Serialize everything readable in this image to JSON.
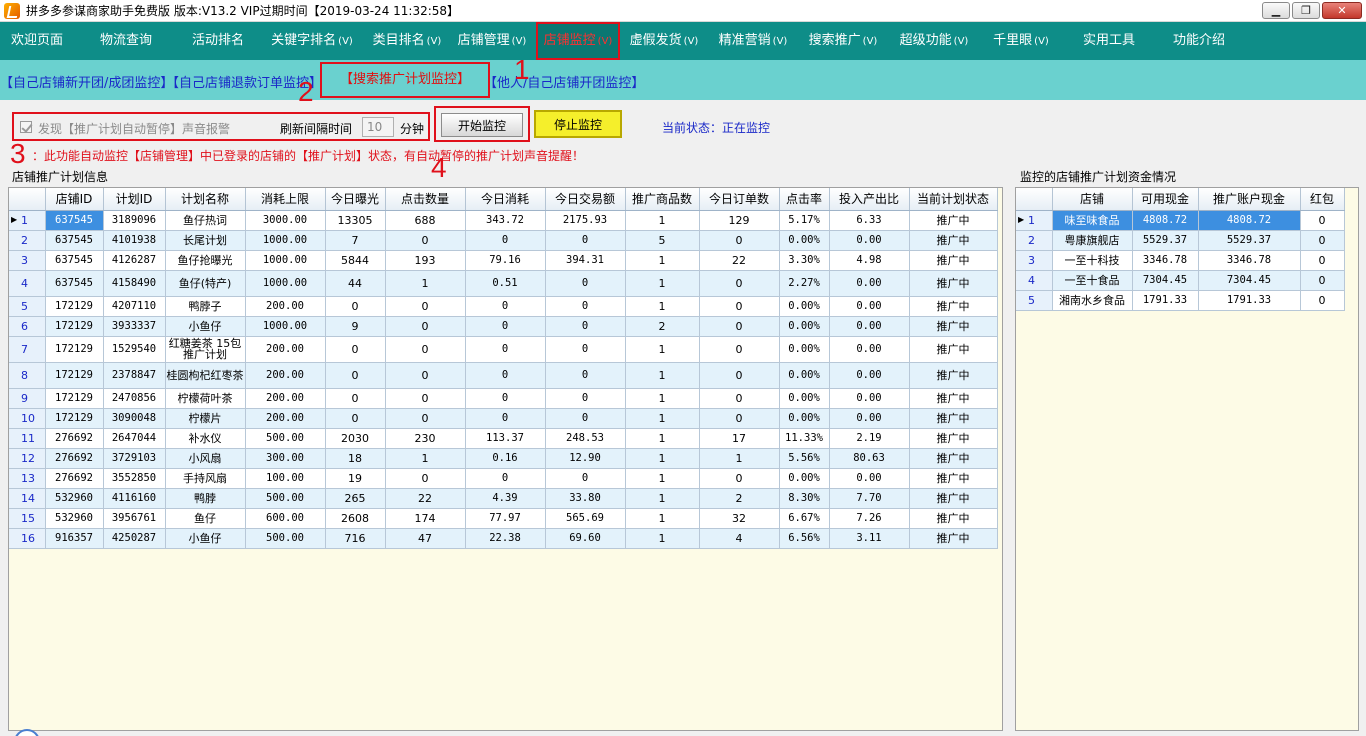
{
  "window": {
    "title": "拼多多参谋商家助手免费版 版本:V13.2 VIP过期时间【2019-03-24 11:32:58】"
  },
  "menu": [
    {
      "label": "欢迎页面",
      "sub": ""
    },
    {
      "label": "物流查询",
      "sub": ""
    },
    {
      "label": "活动排名",
      "sub": ""
    },
    {
      "label": "关键字排名",
      "sub": "(V)"
    },
    {
      "label": "类目排名",
      "sub": "(V)"
    },
    {
      "label": "店铺管理",
      "sub": "(V)"
    },
    {
      "label": "店铺监控",
      "sub": "(V)"
    },
    {
      "label": "虚假发货",
      "sub": "(V)"
    },
    {
      "label": "精准营销",
      "sub": "(V)"
    },
    {
      "label": "搜索推广",
      "sub": "(V)"
    },
    {
      "label": "超级功能",
      "sub": "(V)"
    },
    {
      "label": "千里眼",
      "sub": "(V)"
    },
    {
      "label": "实用工具",
      "sub": ""
    },
    {
      "label": "功能介绍",
      "sub": ""
    }
  ],
  "subtabs": [
    "【自己店铺新开团/成团监控】",
    "【自己店铺退款订单监控】",
    "【搜索推广计划监控】",
    "【他人/自己店铺开团监控】"
  ],
  "callouts": [
    "1",
    "2",
    "3",
    "4"
  ],
  "controls": {
    "sound_alert_label": "发现【推广计划自动暂停】声音报警",
    "interval_label": "刷新间隔时间",
    "interval_value": "10",
    "interval_unit": "分钟",
    "start_label": "开始监控",
    "stop_label": "停止监控",
    "status_label": "当前状态：正在监控"
  },
  "notice": "：此功能自动监控【店铺管理】中已登录的店铺的【推广计划】状态，有自动暂停的推广计划声音提醒！",
  "plans_panel": {
    "title": "店铺推广计划信息",
    "columns": [
      "店铺ID",
      "计划ID",
      "计划名称",
      "消耗上限",
      "今日曝光",
      "点击数量",
      "今日消耗",
      "今日交易额",
      "推广商品数",
      "今日订单数",
      "点击率",
      "投入产出比",
      "当前计划状态"
    ],
    "rows": [
      [
        "637545",
        "3189096",
        "鱼仔热词",
        "3000.00",
        "13305",
        "688",
        "343.72",
        "2175.93",
        "1",
        "129",
        "5.17%",
        "6.33",
        "推广中"
      ],
      [
        "637545",
        "4101938",
        "长尾计划",
        "1000.00",
        "7",
        "0",
        "0",
        "0",
        "5",
        "0",
        "0.00%",
        "0.00",
        "推广中"
      ],
      [
        "637545",
        "4126287",
        "鱼仔抢曝光",
        "1000.00",
        "5844",
        "193",
        "79.16",
        "394.31",
        "1",
        "22",
        "3.30%",
        "4.98",
        "推广中"
      ],
      [
        "637545",
        "4158490",
        "鱼仔(特产)",
        "1000.00",
        "44",
        "1",
        "0.51",
        "0",
        "1",
        "0",
        "2.27%",
        "0.00",
        "推广中"
      ],
      [
        "172129",
        "4207110",
        "鸭脖子",
        "200.00",
        "0",
        "0",
        "0",
        "0",
        "1",
        "0",
        "0.00%",
        "0.00",
        "推广中"
      ],
      [
        "172129",
        "3933337",
        "小鱼仔",
        "1000.00",
        "9",
        "0",
        "0",
        "0",
        "2",
        "0",
        "0.00%",
        "0.00",
        "推广中"
      ],
      [
        "172129",
        "1529540",
        "红糖姜茶 15包推广计划",
        "200.00",
        "0",
        "0",
        "0",
        "0",
        "1",
        "0",
        "0.00%",
        "0.00",
        "推广中"
      ],
      [
        "172129",
        "2378847",
        "桂圆枸杞红枣茶",
        "200.00",
        "0",
        "0",
        "0",
        "0",
        "1",
        "0",
        "0.00%",
        "0.00",
        "推广中"
      ],
      [
        "172129",
        "2470856",
        "柠檬荷叶茶",
        "200.00",
        "0",
        "0",
        "0",
        "0",
        "1",
        "0",
        "0.00%",
        "0.00",
        "推广中"
      ],
      [
        "172129",
        "3090048",
        "柠檬片",
        "200.00",
        "0",
        "0",
        "0",
        "0",
        "1",
        "0",
        "0.00%",
        "0.00",
        "推广中"
      ],
      [
        "276692",
        "2647044",
        "补水仪",
        "500.00",
        "2030",
        "230",
        "113.37",
        "248.53",
        "1",
        "17",
        "11.33%",
        "2.19",
        "推广中"
      ],
      [
        "276692",
        "3729103",
        "小风扇",
        "300.00",
        "18",
        "1",
        "0.16",
        "12.90",
        "1",
        "1",
        "5.56%",
        "80.63",
        "推广中"
      ],
      [
        "276692",
        "3552850",
        "手持风扇",
        "100.00",
        "19",
        "0",
        "0",
        "0",
        "1",
        "0",
        "0.00%",
        "0.00",
        "推广中"
      ],
      [
        "532960",
        "4116160",
        "鸭脖",
        "500.00",
        "265",
        "22",
        "4.39",
        "33.80",
        "1",
        "2",
        "8.30%",
        "7.70",
        "推广中"
      ],
      [
        "532960",
        "3956761",
        "鱼仔",
        "600.00",
        "2608",
        "174",
        "77.97",
        "565.69",
        "1",
        "32",
        "6.67%",
        "7.26",
        "推广中"
      ],
      [
        "916357",
        "4250287",
        "小鱼仔",
        "500.00",
        "716",
        "47",
        "22.38",
        "69.60",
        "1",
        "4",
        "6.56%",
        "3.11",
        "推广中"
      ]
    ]
  },
  "funds_panel": {
    "title": "监控的店铺推广计划资金情况",
    "columns": [
      "店铺",
      "可用现金",
      "推广账户现金",
      "红包"
    ],
    "rows": [
      [
        "味至味食品",
        "4808.72",
        "4808.72",
        "0"
      ],
      [
        "粤康旗舰店",
        "5529.37",
        "5529.37",
        "0"
      ],
      [
        "一至十科技",
        "3346.78",
        "3346.78",
        "0"
      ],
      [
        "一至十食品",
        "7304.45",
        "7304.45",
        "0"
      ],
      [
        "湘南水乡食品",
        "1791.33",
        "1791.33",
        "0"
      ]
    ]
  }
}
